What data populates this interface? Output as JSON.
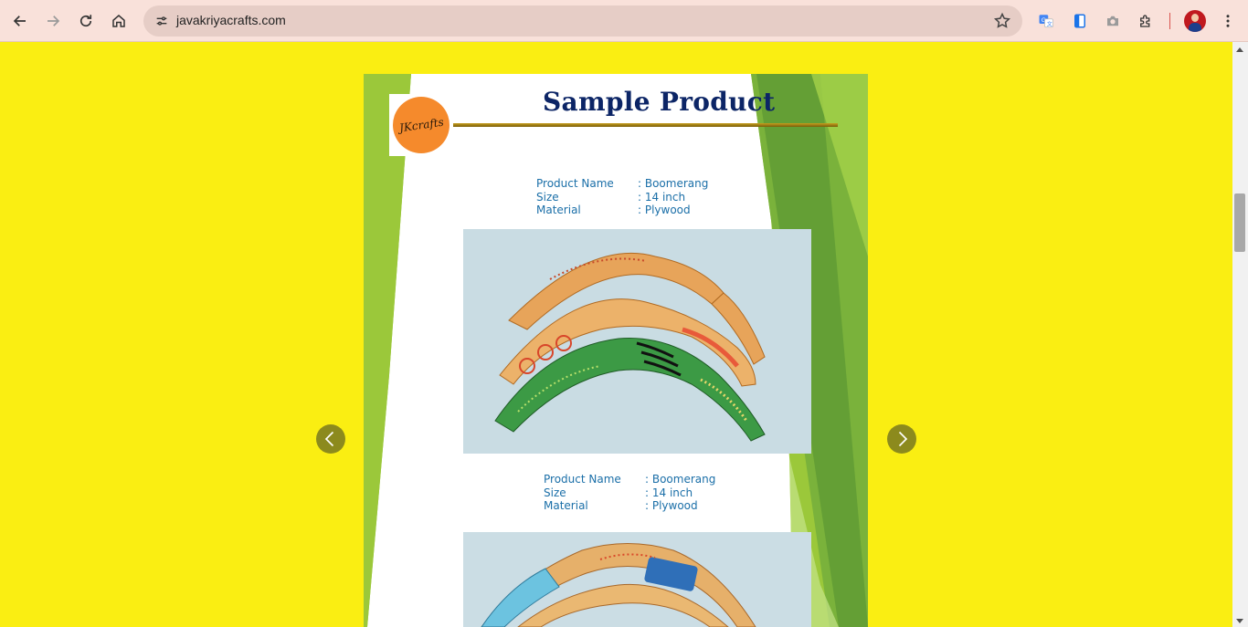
{
  "browser": {
    "url": "javakriyacrafts.com",
    "icons": [
      "back-icon",
      "forward-icon",
      "reload-icon",
      "home-icon",
      "site-settings-icon",
      "bookmark-star-icon",
      "translate-icon",
      "reading-mode-icon",
      "camera-icon",
      "extensions-icon",
      "profile-avatar",
      "menu-icon"
    ],
    "accent": "#f9e1da"
  },
  "page": {
    "background": "#faee12",
    "slide": {
      "title": "Sample Product",
      "logo_text": "JKcrafts",
      "products": [
        {
          "name_label": "Product Name",
          "name_value": ": Boomerang",
          "size_label": "Size",
          "size_value": ": 14 inch",
          "material_label": "Material",
          "material_value": ": Plywood"
        },
        {
          "name_label": "Product Name",
          "name_value": ": Boomerang",
          "size_label": "Size",
          "size_value": ": 14 inch",
          "material_label": "Material",
          "material_value": ": Plywood"
        }
      ]
    },
    "carousel": {
      "prev_icon": "chevron-left-icon",
      "next_icon": "chevron-right-icon",
      "arrow_color": "#8c8a1d"
    }
  }
}
